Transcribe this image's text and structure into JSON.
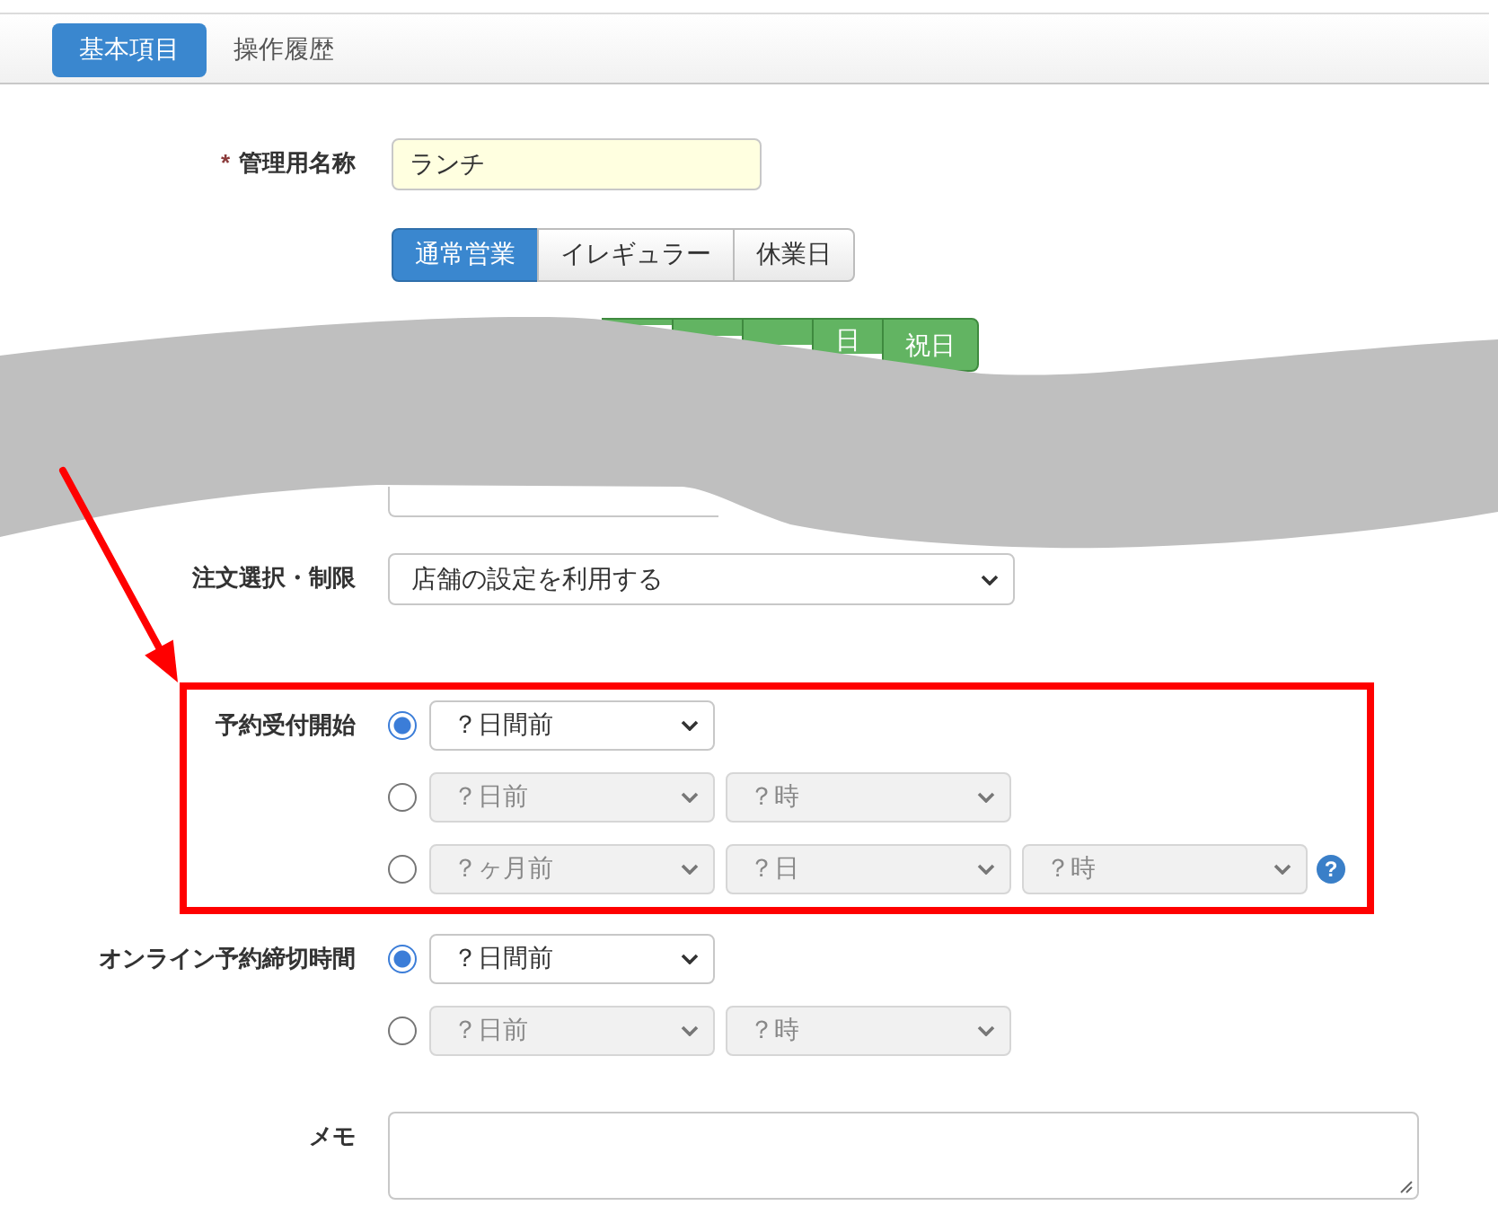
{
  "tabs": [
    {
      "label": "基本項目",
      "selected": true
    },
    {
      "label": "操作履歴",
      "selected": false
    }
  ],
  "name_field": {
    "marker": "*",
    "label": "管理用名称",
    "value": "ランチ"
  },
  "business_type": [
    {
      "label": "通常営業",
      "selected": true
    },
    {
      "label": "イレギュラー",
      "selected": false
    },
    {
      "label": "休業日",
      "selected": false
    }
  ],
  "day_buttons": [
    {
      "selected": true
    },
    {
      "selected": true
    },
    {
      "selected": true
    },
    {
      "label": "日",
      "selected": true
    },
    {
      "label": "祝日",
      "selected": true
    }
  ],
  "order_limit": {
    "label": "注文選択・制限",
    "value": "店舗の設定を利用する"
  },
  "reservation_start": {
    "label": "予約受付開始",
    "highlighted": true,
    "options": [
      {
        "selected": true,
        "selects": [
          {
            "value": "？日間前",
            "disabled": false
          }
        ]
      },
      {
        "selected": false,
        "selects": [
          {
            "value": "？日前",
            "disabled": true
          },
          {
            "value": "？時",
            "disabled": true
          }
        ]
      },
      {
        "selected": false,
        "selects": [
          {
            "value": "？ヶ月前",
            "disabled": true
          },
          {
            "value": "？日",
            "disabled": true
          },
          {
            "value": "？時",
            "disabled": true
          }
        ],
        "help": "?"
      }
    ]
  },
  "online_deadline": {
    "label": "オンライン予約締切時間",
    "options": [
      {
        "selected": true,
        "selects": [
          {
            "value": "？日間前",
            "disabled": false
          }
        ]
      },
      {
        "selected": false,
        "selects": [
          {
            "value": "？日前",
            "disabled": true
          },
          {
            "value": "？時",
            "disabled": true
          }
        ]
      }
    ]
  },
  "memo": {
    "label": "メモ"
  }
}
